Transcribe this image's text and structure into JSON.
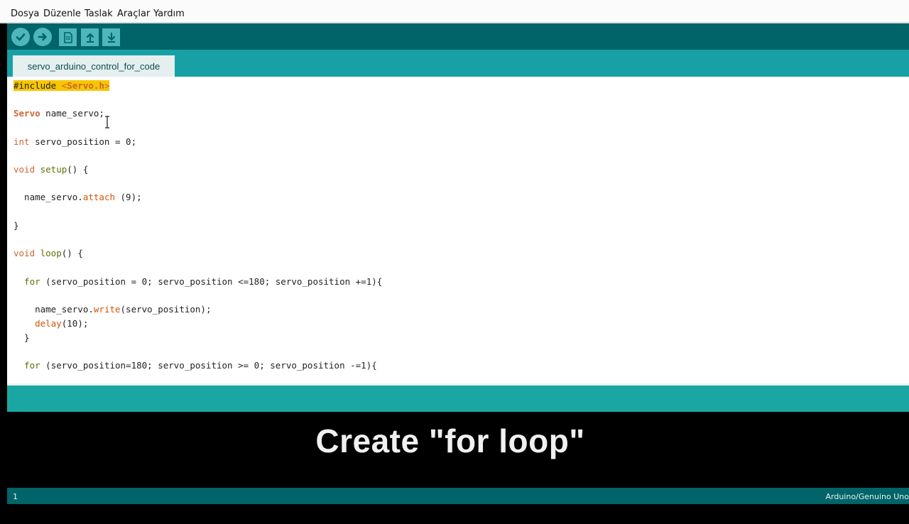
{
  "menu": [
    "Dosya",
    "Düzenle",
    "Taslak",
    "Araçlar",
    "Yardım"
  ],
  "toolbar": {
    "verify_icon": "check-icon",
    "upload_icon": "arrow-right-icon",
    "new_icon": "new-file-icon",
    "open_icon": "open-arrow-up-icon",
    "save_icon": "save-arrow-down-icon"
  },
  "tab": {
    "label": "servo_arduino_control_for_code"
  },
  "code": {
    "l1_inc": "#include ",
    "l1_lt": "<",
    "l1_hdr": "Servo.h",
    "l1_gt": ">",
    "l2_type": "Servo",
    "l2_rest": " name_servo;",
    "l3_type": "int",
    "l3_rest": " servo_position = 0;",
    "l4_void": "void",
    "l4_fn": " setup",
    "l4_rest": "() {",
    "l5_pre": "  name_servo.",
    "l5_fn": "attach",
    "l5_rest": " (9);",
    "l6": "}",
    "l7_void": "void",
    "l7_fn": " loop",
    "l7_rest": "() {",
    "l8_for": "  for",
    "l8_rest": " (servo_position = 0; servo_position <=180; servo_position +=1){",
    "l9_pre": "    name_servo.",
    "l9_fn": "write",
    "l9_rest": "(servo_position);",
    "l10_pre": "    ",
    "l10_fn": "delay",
    "l10_rest": "(10);",
    "l11": "  }",
    "l12_for": "  for",
    "l12_rest": " (servo_position=180; servo_position >= 0; servo_position -=1){"
  },
  "caption": "Create \"for loop\"",
  "status": {
    "line": "1",
    "board": "Arduino/Genuino Uno"
  },
  "colors": {
    "toolbar": "#006468",
    "tabstrip": "#17a1a5",
    "highlight": "#f7c600"
  }
}
